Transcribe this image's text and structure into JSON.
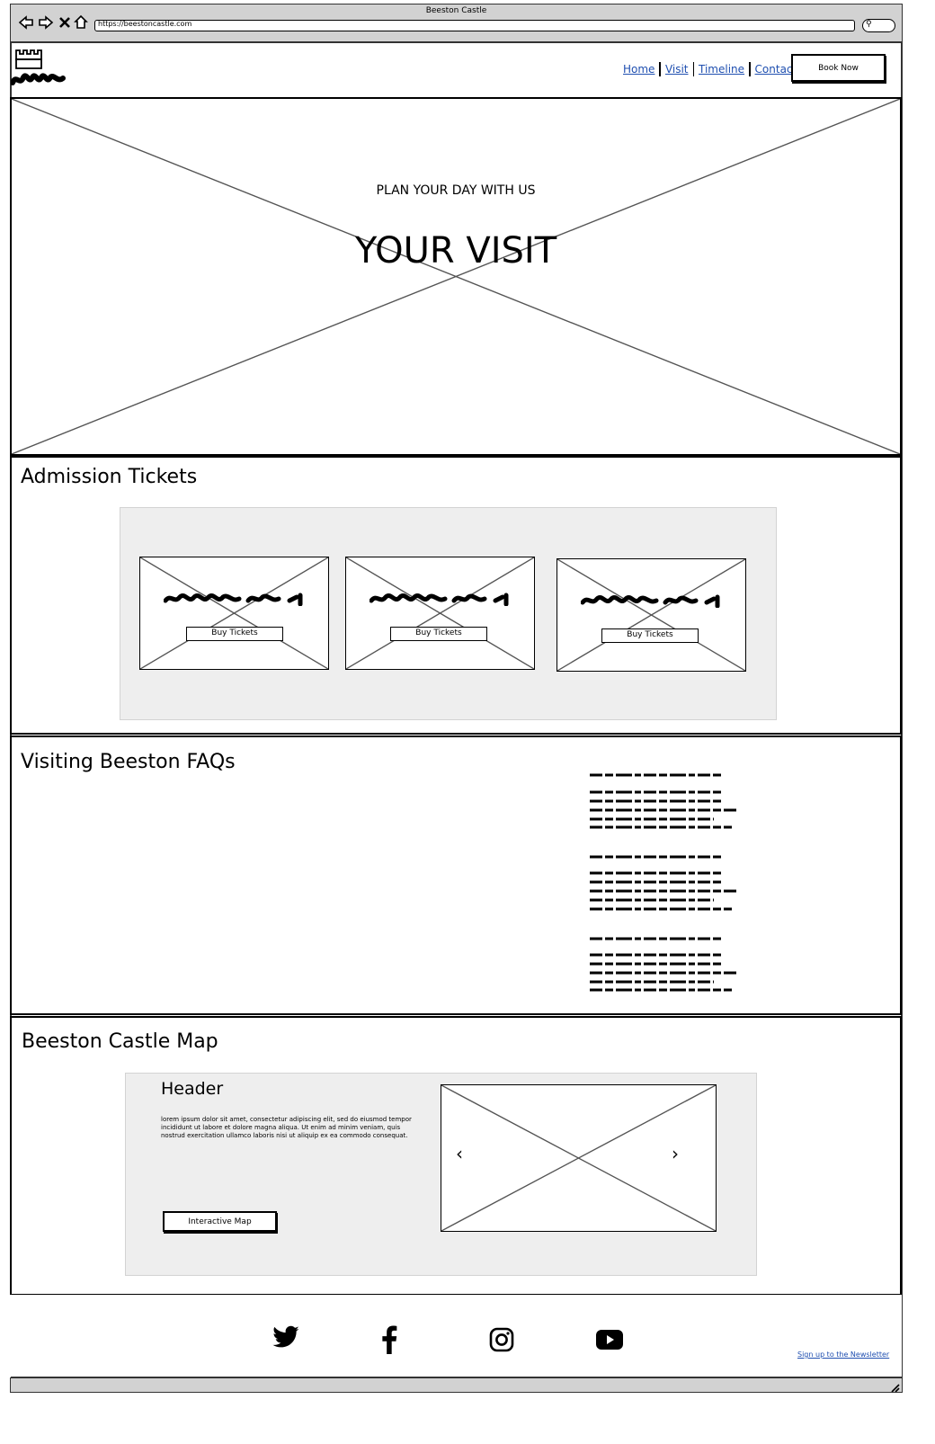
{
  "browser": {
    "window_title": "Beeston Castle",
    "url": "https://beestoncastle.com"
  },
  "header": {
    "nav": [
      "Home",
      "Visit",
      "Timeline",
      "Contact"
    ],
    "cta_label": "Book Now"
  },
  "hero": {
    "eyebrow": "PLAN YOUR DAY WITH US",
    "title": "YOUR VISIT"
  },
  "tickets": {
    "heading": "Admission Tickets",
    "cards": [
      {
        "button_label": "Buy Tickets"
      },
      {
        "button_label": "Buy Tickets"
      },
      {
        "button_label": "Buy Tickets"
      }
    ]
  },
  "faqs": {
    "heading": "Visiting Beeston FAQs"
  },
  "map": {
    "heading": "Beeston Castle Map",
    "panel_header": "Header",
    "panel_text": "lorem ipsum dolor sit amet, consectetur adipiscing elit, sed do eiusmod tempor incididunt ut labore et dolore magna aliqua. Ut enim ad minim veniam, quis nostrud exercitation ullamco laboris nisi ut aliquip ex ea commodo consequat.",
    "button_label": "Interactive Map",
    "carousel_prev": "‹",
    "carousel_next": "›"
  },
  "footer": {
    "social_icons": [
      "twitter-icon",
      "facebook-icon",
      "instagram-icon",
      "youtube-icon"
    ],
    "newsletter_link": "Sign up to the Newsletter"
  }
}
